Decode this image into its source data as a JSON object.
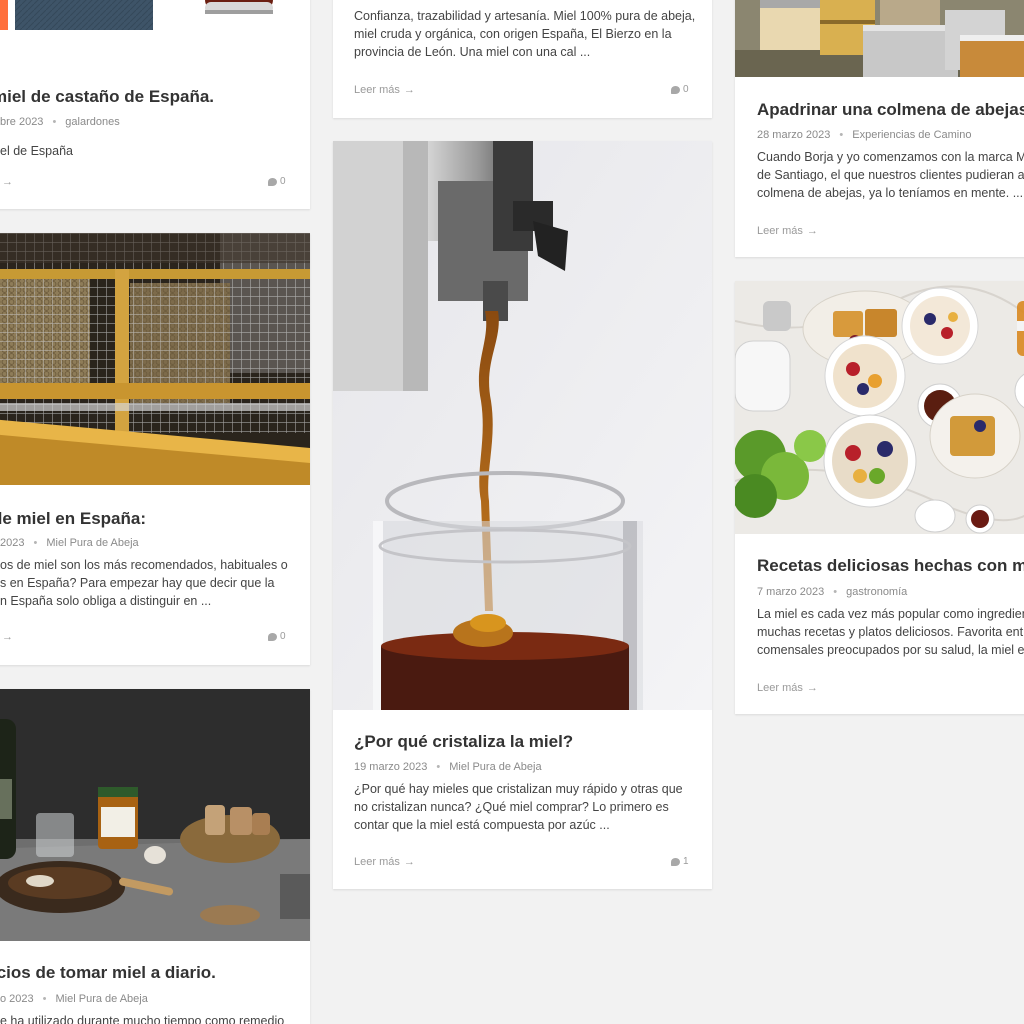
{
  "posts": [
    {
      "title": " miel de castaño de España.",
      "date": "bre 2023",
      "category": "galardones",
      "excerpt": [
        "el de España"
      ],
      "read_more": "",
      "comments": "0"
    },
    {
      "title": " de miel en España:",
      "date": "2023",
      "category": "Miel Pura de Abeja",
      "excerpt": [
        "os de miel son los más recomendados, habituales o",
        "s en España? Para empezar hay que decir que la",
        "n España solo obliga a distinguir en ..."
      ],
      "read_more": "",
      "comments": "0"
    },
    {
      "title": "icios de tomar miel a diario.",
      "date": "o 2023",
      "category": "Miel Pura de Abeja",
      "excerpt": [
        "e ha utilizado durante mucho tiempo como remedio"
      ]
    },
    {
      "excerpt": [
        "Confianza, trazabilidad y artesanía. Miel 100% pura de abeja,",
        "miel cruda y orgánica, con origen España, El Bierzo en la",
        "provincia de León. Una miel con una cal ..."
      ],
      "read_more": "Leer más",
      "comments": "0"
    },
    {
      "title": "¿Por qué cristaliza la miel?",
      "date": "19 marzo 2023",
      "category": "Miel Pura de Abeja",
      "excerpt": [
        "¿Por qué hay mieles que cristalizan muy rápido y otras que",
        "no cristalizan nunca? ¿Qué miel comprar? Lo primero es",
        "contar que la miel está compuesta por azúc ..."
      ],
      "read_more": "Leer más",
      "comments": "1"
    },
    {
      "title": "Apadrinar una colmena de abejas",
      "date": "28 marzo 2023",
      "category": "Experiencias de Camino",
      "excerpt": [
        "Cuando Borja y yo comenzamos con la marca Mi",
        "de Santiago, el que nuestros clientes pudieran ap",
        "colmena de abejas, ya lo teníamos en mente. ..."
      ],
      "read_more": "Leer más"
    },
    {
      "title": "Recetas deliciosas hechas con m",
      "date": "7 marzo 2023",
      "category": "gastronomía",
      "excerpt": [
        "La miel es cada vez más popular como ingredient",
        "muchas recetas y platos deliciosos. Favorita entr",
        "comensales preocupados por su salud, la miel es"
      ],
      "read_more": "Leer más"
    }
  ],
  "arrow": "→",
  "colors": {
    "accent": "#ff6f3c",
    "text": "#333333",
    "meta": "#8a8a8a"
  }
}
